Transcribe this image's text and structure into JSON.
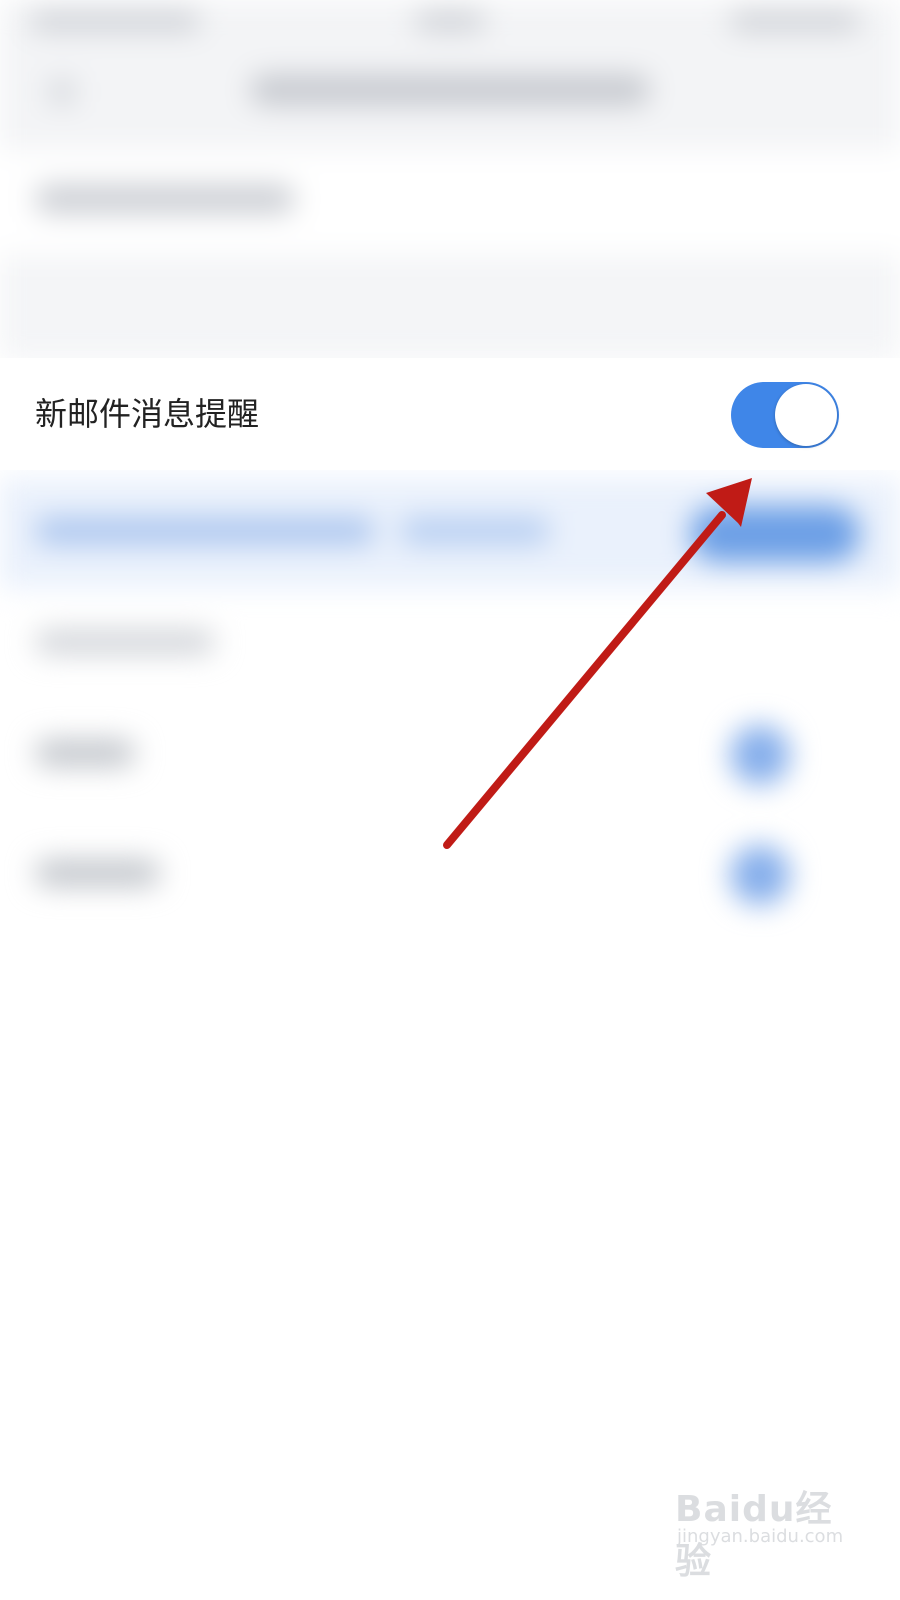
{
  "setting": {
    "label": "新邮件消息提醒",
    "toggle_state": "on",
    "toggle_color": "#3f86e8"
  },
  "annotation": {
    "arrow_color": "#c01b16"
  },
  "watermark": {
    "logo_text": "Baidu经验",
    "url_text": "jingyan.baidu.com"
  },
  "colors": {
    "accent_blue": "#3f86e8",
    "page_background": "#ffffff"
  }
}
